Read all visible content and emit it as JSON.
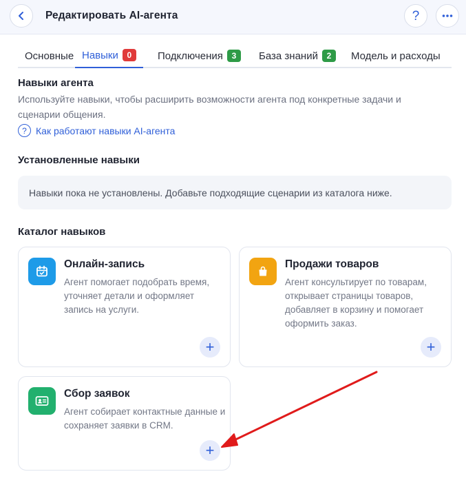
{
  "header": {
    "title": "Редактировать AI-агента",
    "help_label": "?",
    "back_icon": "chevron-left-icon",
    "more_icon": "ellipsis-icon"
  },
  "tabs": [
    {
      "label": "Основные",
      "badge": "",
      "active": false
    },
    {
      "label": "Навыки",
      "badge": "0",
      "badge_color": "#e03a3a",
      "active": true
    },
    {
      "label": "Подключения",
      "badge": "3",
      "badge_color": "#2e9b47",
      "active": false
    },
    {
      "label": "База знаний",
      "badge": "2",
      "badge_color": "#2e9b47",
      "active": false
    },
    {
      "label": "Модель и расходы",
      "badge": "",
      "active": false
    }
  ],
  "skills": {
    "title": "Навыки агента",
    "description": "Используйте навыки, чтобы расширить возможности агента под конкретные задачи и сценарии общения.",
    "help_link": "Как работают навыки AI-агента",
    "help_icon_glyph": "?"
  },
  "installed": {
    "title": "Установленные навыки",
    "empty_text": "Навыки пока не установлены. Добавьте подходящие сценарии из каталога ниже."
  },
  "catalog": {
    "title": "Каталог навыков",
    "add_glyph": "+",
    "cards": [
      {
        "title": "Онлайн-запись",
        "description": "Агент помогает подобрать время, уточняет детали и оформляет запись на услуги.",
        "icon": "calendar-icon",
        "color": "#1e9be8"
      },
      {
        "title": "Продажи товаров",
        "description": "Агент консультирует по товарам, открывает страницы товаров, добавляет в корзину и помогает оформить заказ.",
        "icon": "shopping-bag-icon",
        "color": "#f2a411"
      },
      {
        "title": "Сбор заявок",
        "description": "Агент собирает контактные данные и сохраняет заявки в CRM.",
        "icon": "contact-card-icon",
        "color": "#22b06e"
      }
    ]
  },
  "annotation": {
    "color": "#e01b1b"
  }
}
